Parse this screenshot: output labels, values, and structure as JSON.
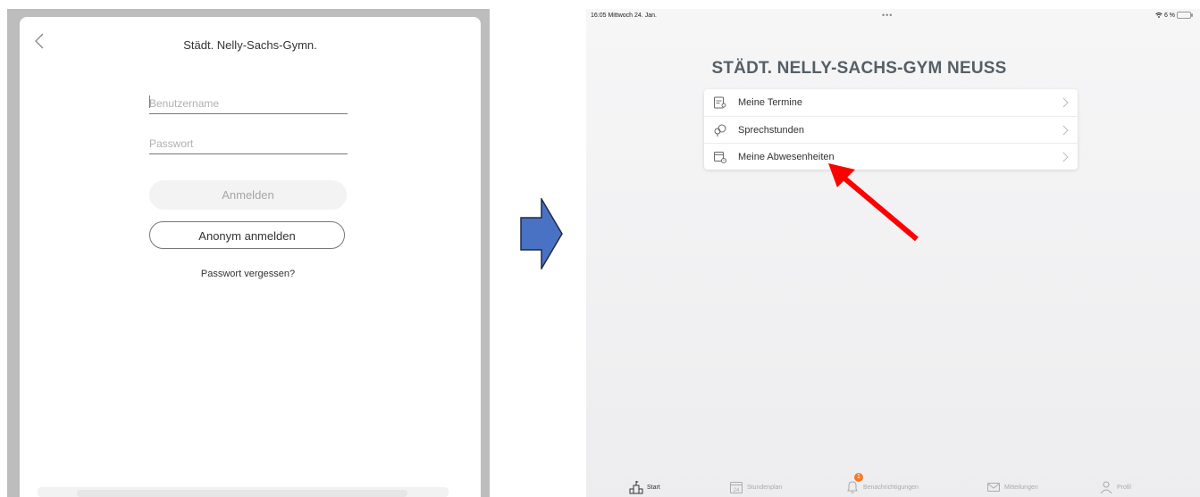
{
  "left_screen": {
    "title": "Städt. Nelly-Sachs-Gymn.",
    "username_placeholder": "Benutzername",
    "password_placeholder": "Passwort",
    "login_button": "Anmelden",
    "anonymous_button": "Anonym anmelden",
    "forgot_link": "Passwort vergessen?"
  },
  "right_screen": {
    "status_bar": {
      "time_date": "16:05  Mittwoch 24. Jan.",
      "dots": "•••",
      "battery": "6 %"
    },
    "school_title": "STÄDT. NELLY-SACHS-GYM NEUSS",
    "menu_items": [
      {
        "label": "Meine Termine",
        "icon": "calendar-person-icon"
      },
      {
        "label": "Sprechstunden",
        "icon": "speech-bubbles-icon"
      },
      {
        "label": "Meine Abwesenheiten",
        "icon": "calendar-clock-icon"
      }
    ],
    "tab_bar": [
      {
        "label": "Start",
        "icon": "school-building-icon",
        "active": true
      },
      {
        "label": "Stundenplan",
        "icon": "calendar-24-icon",
        "active": false
      },
      {
        "label": "Benachrichtigungen",
        "icon": "bell-icon",
        "active": false,
        "badge": "1"
      },
      {
        "label": "Mitteilungen",
        "icon": "envelope-icon",
        "active": false
      },
      {
        "label": "Profil",
        "icon": "person-icon",
        "active": false
      }
    ]
  },
  "colors": {
    "arrow_blue": "#4a72c4",
    "highlight_red": "#ff0000",
    "badge_orange": "#f07a2c"
  }
}
